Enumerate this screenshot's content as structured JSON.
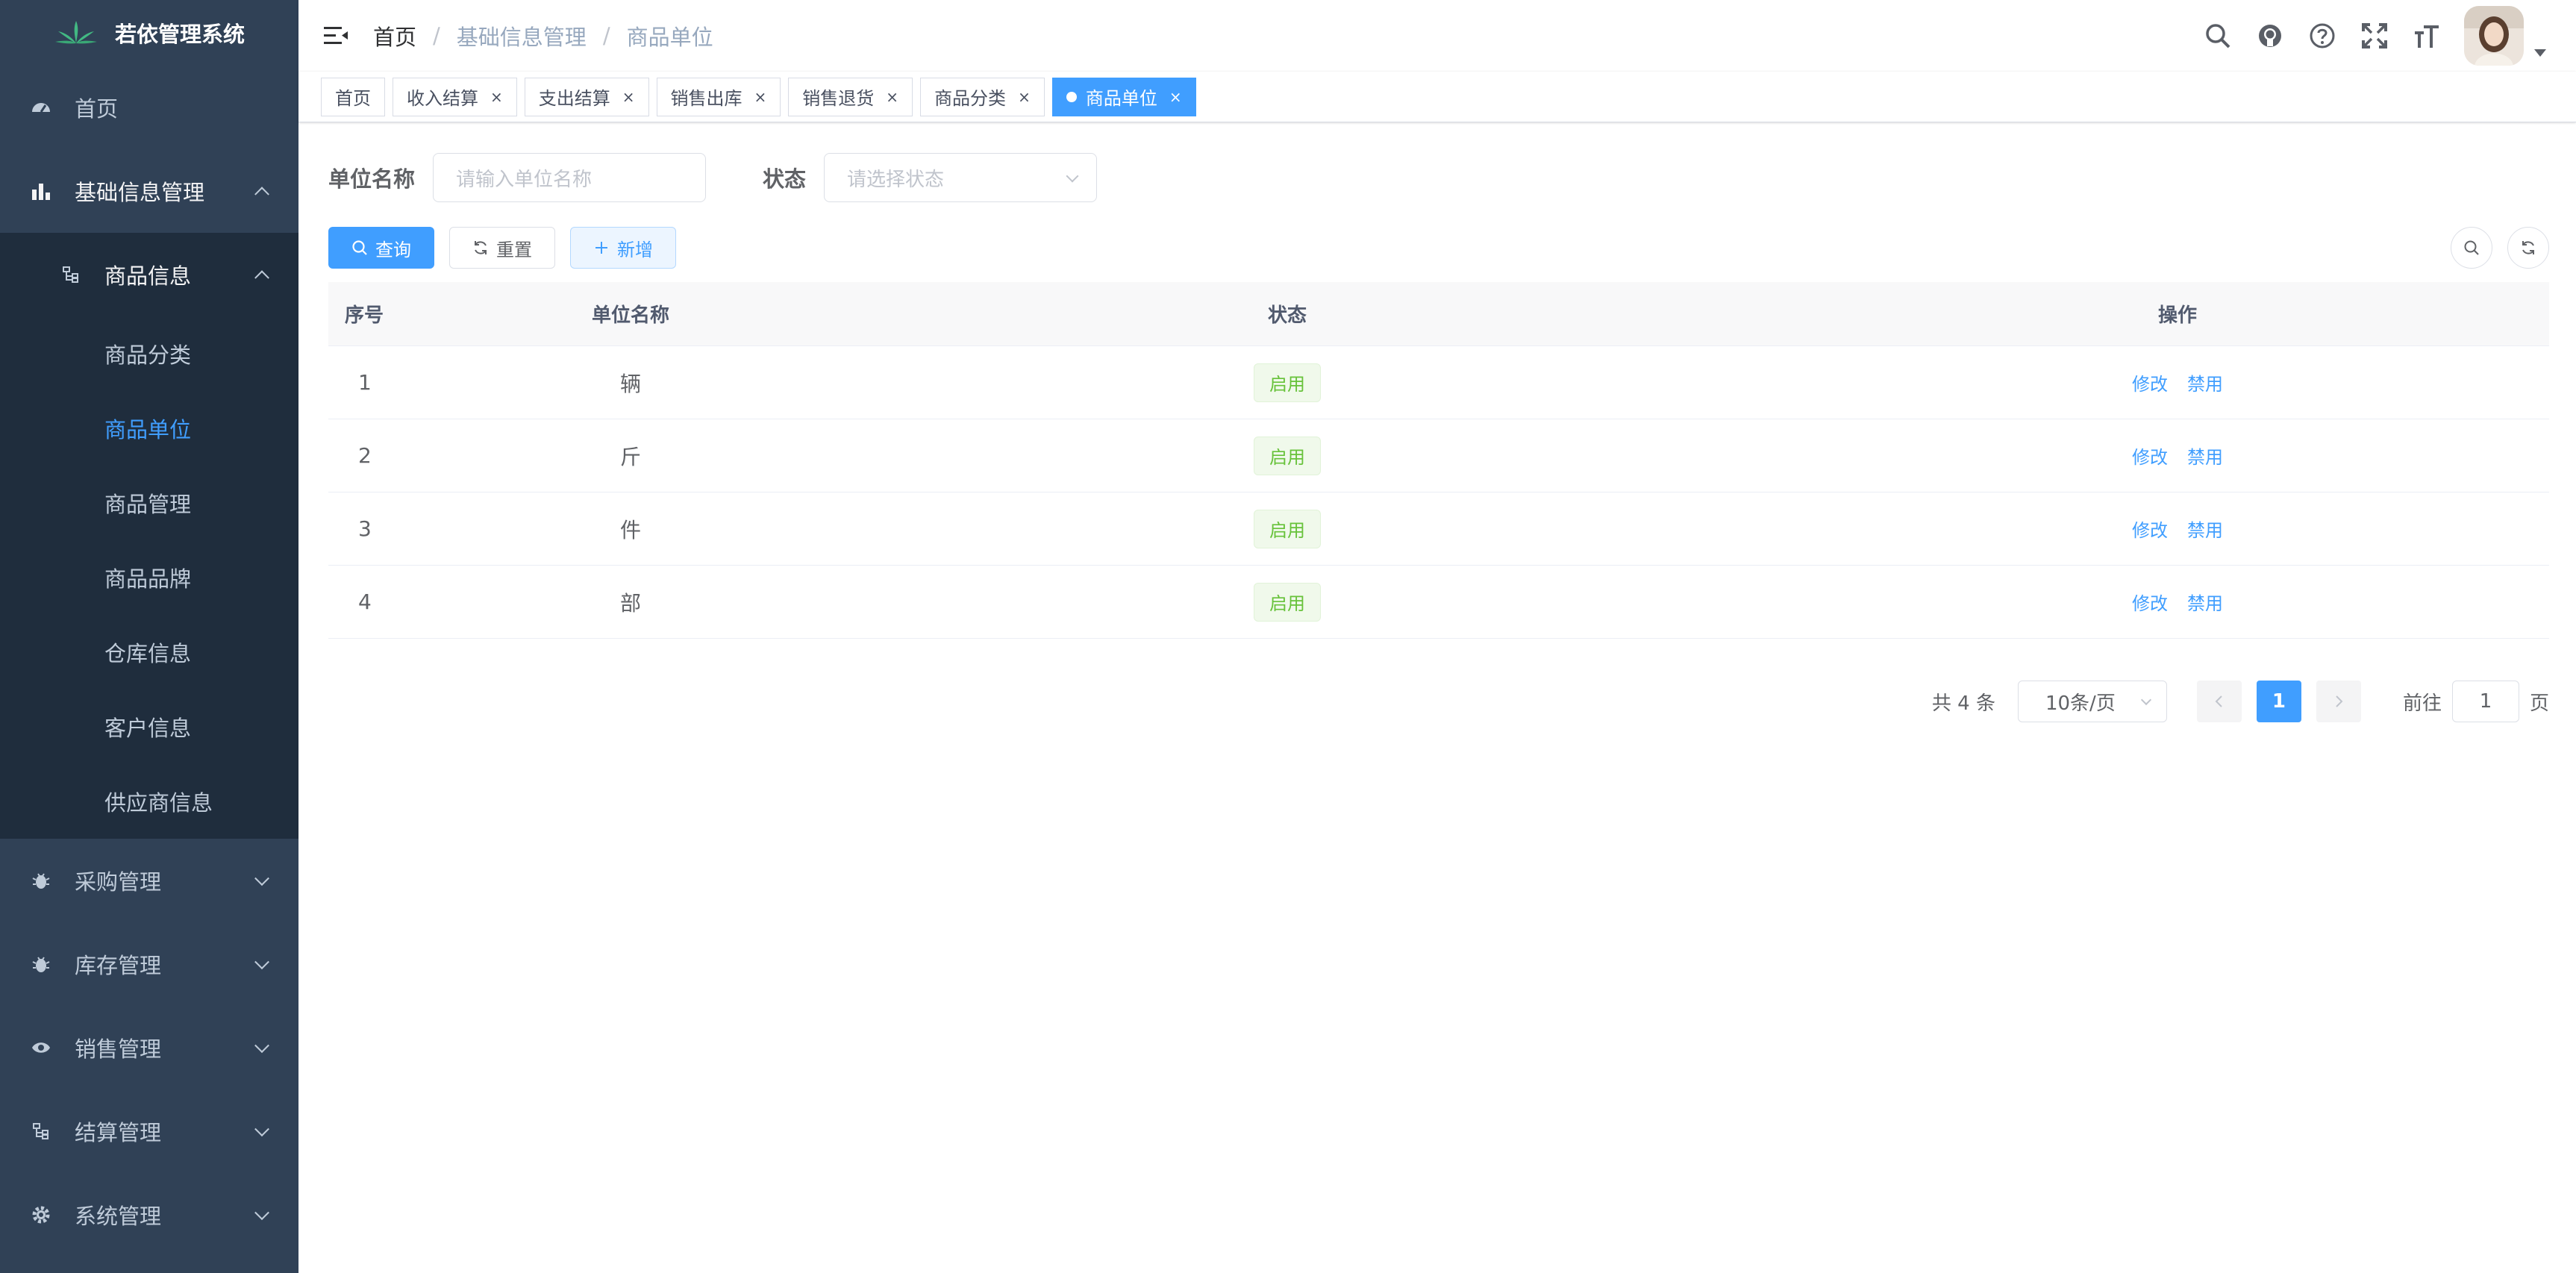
{
  "app": {
    "title": "若依管理系统"
  },
  "sidebar": {
    "home": "首页",
    "basic": {
      "label": "基础信息管理",
      "product_info": {
        "label": "商品信息",
        "items": [
          "商品分类",
          "商品单位",
          "商品管理",
          "商品品牌"
        ]
      },
      "items": [
        "仓库信息",
        "客户信息",
        "供应商信息"
      ]
    },
    "bottom": [
      "采购管理",
      "库存管理",
      "销售管理",
      "结算管理",
      "系统管理"
    ]
  },
  "navbar": {
    "breadcrumb": [
      "首页",
      "基础信息管理",
      "商品单位"
    ],
    "separator": "/"
  },
  "tags": [
    {
      "label": "首页",
      "closable": false
    },
    {
      "label": "收入结算",
      "closable": true
    },
    {
      "label": "支出结算",
      "closable": true
    },
    {
      "label": "销售出库",
      "closable": true
    },
    {
      "label": "销售退货",
      "closable": true
    },
    {
      "label": "商品分类",
      "closable": true
    },
    {
      "label": "商品单位",
      "closable": true,
      "active": true
    }
  ],
  "tag_close_glyph": "×",
  "query": {
    "name_label": "单位名称",
    "name_placeholder": "请输入单位名称",
    "status_label": "状态",
    "status_placeholder": "请选择状态"
  },
  "buttons": {
    "search": "查询",
    "reset": "重置",
    "add": "新增"
  },
  "table": {
    "columns": [
      "序号",
      "单位名称",
      "状态",
      "操作"
    ],
    "rows": [
      {
        "index": "1",
        "name": "辆",
        "status": "启用"
      },
      {
        "index": "2",
        "name": "斤",
        "status": "启用"
      },
      {
        "index": "3",
        "name": "件",
        "status": "启用"
      },
      {
        "index": "4",
        "name": "部",
        "status": "启用"
      }
    ],
    "op_edit": "修改",
    "op_disable": "禁用"
  },
  "pagination": {
    "total": "共 4 条",
    "page_size": "10条/页",
    "current_page": "1",
    "goto_label": "前往",
    "goto_value": "1",
    "page_suffix": "页"
  },
  "colors": {
    "sidebar_bg": "#304156",
    "submenu_bg": "#1f2d3d",
    "primary": "#409eff",
    "success": "#67c23a"
  }
}
